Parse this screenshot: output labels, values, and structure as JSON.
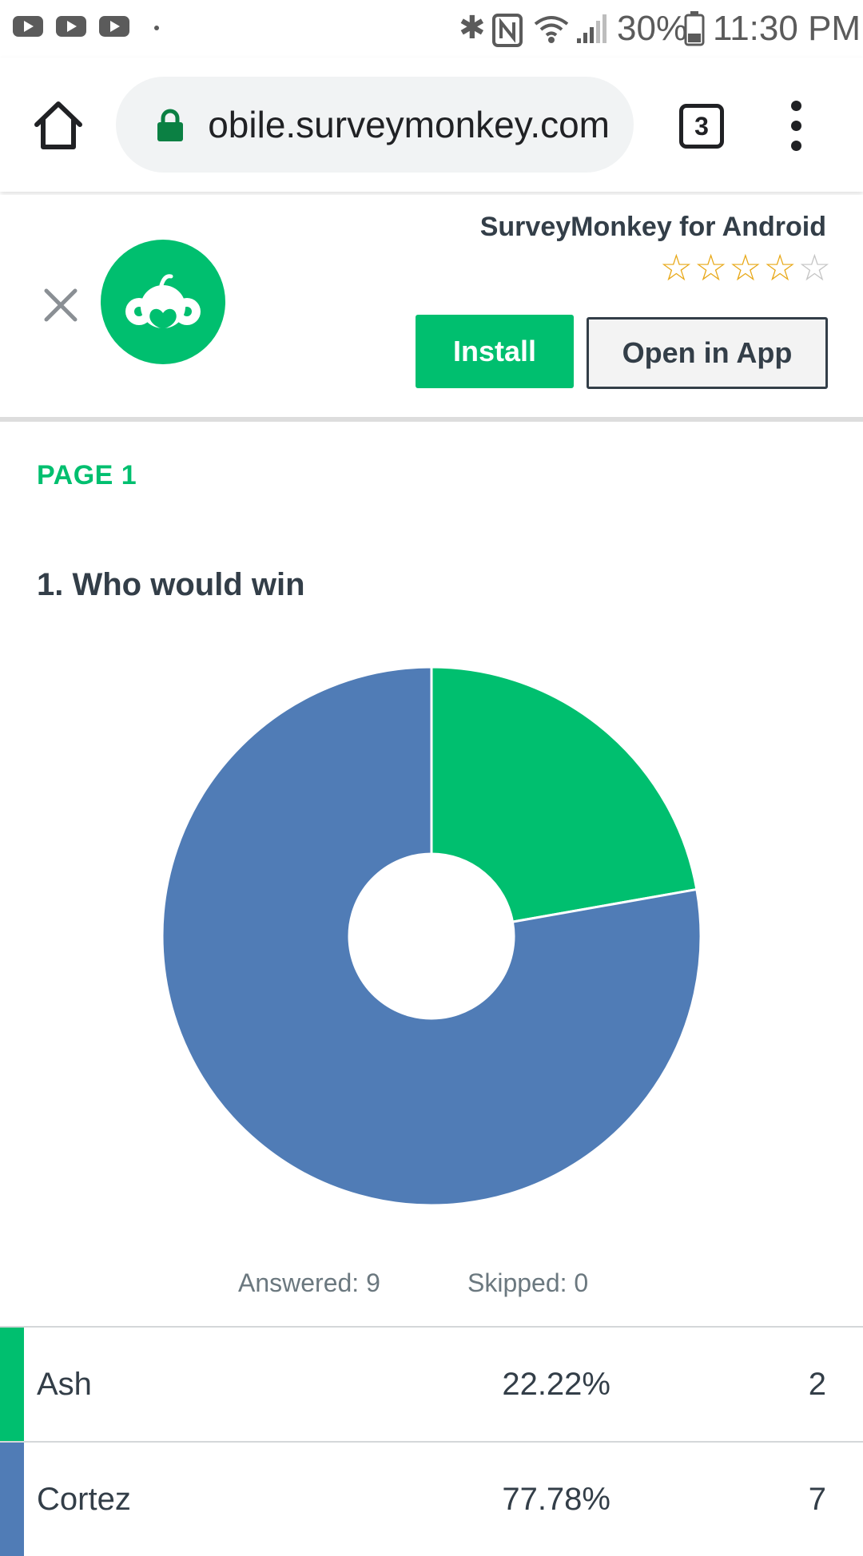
{
  "status_bar": {
    "notification_icons": [
      "youtube-icon",
      "youtube-icon",
      "youtube-icon"
    ],
    "battery": "30%",
    "time": "11:30 PM"
  },
  "browser": {
    "url": "mobile.surveymonkey.com",
    "tab_count": "3"
  },
  "app_banner": {
    "title": "SurveyMonkey for Android",
    "rating": 4,
    "rating_max": 5,
    "install_label": "Install",
    "open_label": "Open in App",
    "brand_color": "#00bf6f",
    "star_color": "#e8a818"
  },
  "page": {
    "label": "PAGE 1",
    "question": "1. Who would win",
    "answered": "Answered: 9",
    "skipped": "Skipped: 0"
  },
  "chart_data": {
    "type": "pie",
    "style": "donut",
    "series": [
      {
        "label": "Ash",
        "value": 22.22,
        "count": 2,
        "color": "#00bf6f"
      },
      {
        "label": "Cortez",
        "value": 77.78,
        "count": 7,
        "color": "#507cb6"
      }
    ]
  },
  "results": [
    {
      "label": "Ash",
      "percent": "22.22%",
      "count": "2",
      "color": "#00bf6f"
    },
    {
      "label": "Cortez",
      "percent": "77.78%",
      "count": "7",
      "color": "#507cb6"
    }
  ]
}
